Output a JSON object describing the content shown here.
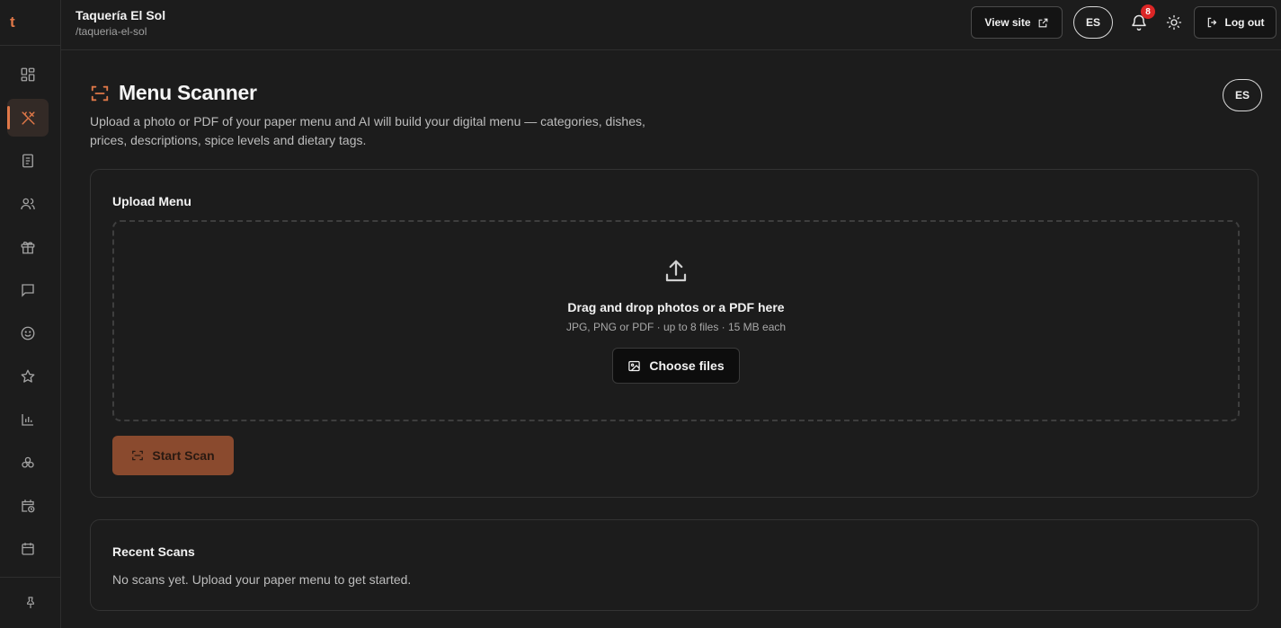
{
  "app": {
    "logo_letter": "t"
  },
  "header": {
    "org_name": "Taquería El Sol",
    "org_slug": "/taqueria-el-sol",
    "view_site_label": "View site",
    "language_label": "ES",
    "notification_count": "8",
    "logout_label": "Log out"
  },
  "sidebar": {
    "items": [
      {
        "icon": "dashboard-icon",
        "active": false
      },
      {
        "icon": "utensils-icon",
        "active": true
      },
      {
        "icon": "document-icon",
        "active": false
      },
      {
        "icon": "users-icon",
        "active": false
      },
      {
        "icon": "gift-icon",
        "active": false
      },
      {
        "icon": "message-icon",
        "active": false
      },
      {
        "icon": "smiley-icon",
        "active": false
      },
      {
        "icon": "star-icon",
        "active": false
      },
      {
        "icon": "bar-chart-icon",
        "active": false
      },
      {
        "icon": "cluster-icon",
        "active": false
      },
      {
        "icon": "calendar-clock-icon",
        "active": false
      },
      {
        "icon": "calendar-icon",
        "active": false
      }
    ],
    "bottom_icon": "pin-icon"
  },
  "page": {
    "title": "Menu Scanner",
    "description": "Upload a photo or PDF of your paper menu and AI will build your digital menu — categories, dishes, prices, descriptions, spice levels and dietary tags.",
    "language_label": "ES"
  },
  "upload": {
    "title": "Upload Menu",
    "drop_heading": "Drag and drop photos or a PDF here",
    "drop_hint": "JPG, PNG or PDF · up to 8 files · 15 MB each",
    "choose_label": "Choose files",
    "start_label": "Start Scan"
  },
  "recent": {
    "title": "Recent Scans",
    "empty_text": "No scans yet. Upload your paper menu to get started."
  },
  "colors": {
    "accent": "#e07848",
    "badge": "#dc2626",
    "start_button": "#8a4a2e",
    "background": "#1c1c1c"
  }
}
